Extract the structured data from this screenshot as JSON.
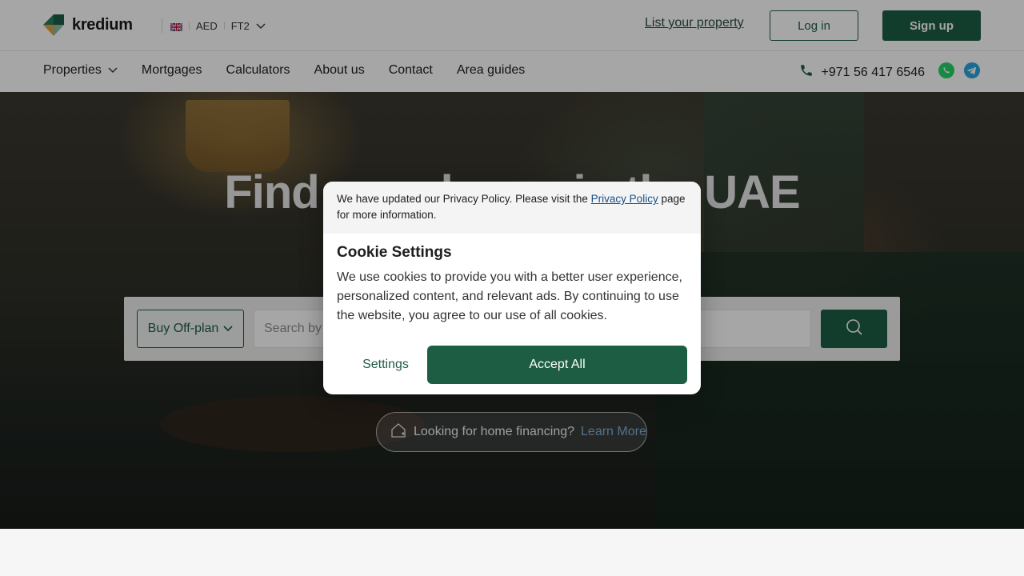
{
  "header": {
    "brand": "kredium",
    "currency": "AED",
    "unit": "FT2",
    "list_property": "List your property",
    "login": "Log in",
    "signup": "Sign up"
  },
  "nav": {
    "items": [
      "Properties",
      "Mortgages",
      "Calculators",
      "About us",
      "Contact",
      "Area guides"
    ],
    "phone": "+971 56 417 6546"
  },
  "hero": {
    "title": "Find your home in the UAE",
    "search_type": "Buy Off-plan",
    "search_placeholder": "Search by",
    "finance_text": "Looking for home financing?",
    "finance_link": "Learn More"
  },
  "cookie_modal": {
    "notice_pre": "We have updated our Privacy Policy. Please visit the ",
    "notice_link": "Privacy Policy",
    "notice_post": " page for more information.",
    "title": "Cookie Settings",
    "body": "We use cookies to provide you with a better user experience, personalized content, and relevant ads. By continuing to use the website, you agree to our use of all cookies.",
    "settings": "Settings",
    "accept": "Accept All"
  },
  "colors": {
    "brand_green": "#1c5d44",
    "whatsapp": "#25d366",
    "telegram": "#2aa3dc"
  },
  "icons": [
    "kredium-logo-icon",
    "uk-flag-icon",
    "chevron-down-icon",
    "phone-icon",
    "whatsapp-icon",
    "telegram-icon",
    "search-icon",
    "house-icon"
  ]
}
